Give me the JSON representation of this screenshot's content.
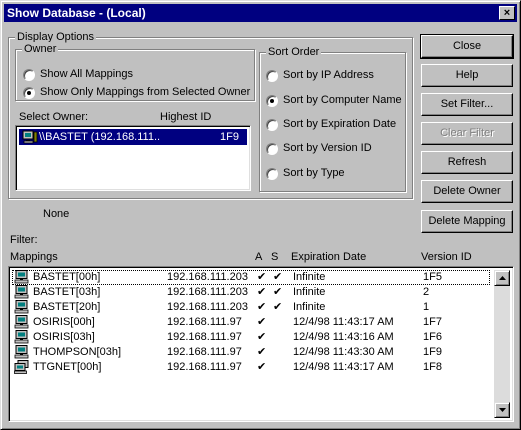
{
  "window": {
    "title": "Show Database - (Local)",
    "close_glyph": "×"
  },
  "display_options": {
    "label": "Display Options",
    "owner_group": {
      "label": "Owner",
      "options": [
        {
          "label": "Show All Mappings",
          "checked": false
        },
        {
          "label": "Show Only Mappings from Selected Owner",
          "checked": true
        }
      ]
    },
    "select_owner_label": "Select Owner:",
    "highest_id_label": "Highest ID",
    "owners": [
      {
        "name": "\\\\BASTET (192.168.111..",
        "highest_id": "1F9",
        "selected": true
      }
    ]
  },
  "sort_order": {
    "label": "Sort Order",
    "options": [
      {
        "label": "Sort by IP Address",
        "checked": false
      },
      {
        "label": "Sort by Computer Name",
        "checked": true
      },
      {
        "label": "Sort by Expiration Date",
        "checked": false
      },
      {
        "label": "Sort by Version ID",
        "checked": false
      },
      {
        "label": "Sort by Type",
        "checked": false
      }
    ]
  },
  "buttons": {
    "close": "Close",
    "help": "Help",
    "set_filter": "Set Filter...",
    "clear_filter": "Clear Filter",
    "refresh": "Refresh",
    "delete_owner": "Delete Owner",
    "delete_mapping": "Delete Mapping"
  },
  "filter_value": "None",
  "filter_label": "Filter:",
  "mappings": {
    "headers": {
      "name": "Mappings",
      "a": "A",
      "s": "S",
      "expiration": "Expiration Date",
      "version": "Version ID"
    },
    "rows": [
      {
        "name": "BASTET[00h]",
        "ip": "192.168.111.203",
        "a": "✔",
        "s": "✔",
        "expiration": "Infinite",
        "version": "1F5",
        "icon": "computer-icon"
      },
      {
        "name": "BASTET[03h]",
        "ip": "192.168.111.203",
        "a": "✔",
        "s": "✔",
        "expiration": "Infinite",
        "version": "2",
        "icon": "computer-icon"
      },
      {
        "name": "BASTET[20h]",
        "ip": "192.168.111.203",
        "a": "✔",
        "s": "✔",
        "expiration": "Infinite",
        "version": "1",
        "icon": "computer-icon"
      },
      {
        "name": "OSIRIS[00h]",
        "ip": "192.168.111.97",
        "a": "✔",
        "s": "",
        "expiration": "12/4/98 11:43:17 AM",
        "version": "1F7",
        "icon": "computer-icon"
      },
      {
        "name": "OSIRIS[03h]",
        "ip": "192.168.111.97",
        "a": "✔",
        "s": "",
        "expiration": "12/4/98 11:43:16 AM",
        "version": "1F6",
        "icon": "computer-icon"
      },
      {
        "name": "THOMPSON[03h]",
        "ip": "192.168.111.97",
        "a": "✔",
        "s": "",
        "expiration": "12/4/98 11:43:30 AM",
        "version": "1F9",
        "icon": "computer-icon"
      },
      {
        "name": "TTGNET[00h]",
        "ip": "192.168.111.97",
        "a": "✔",
        "s": "",
        "expiration": "12/4/98 11:43:17 AM",
        "version": "1F8",
        "icon": "group-icon"
      }
    ]
  },
  "colors": {
    "face": "#c0c0c0",
    "titlebar": "#000080",
    "selection": "#000080"
  }
}
